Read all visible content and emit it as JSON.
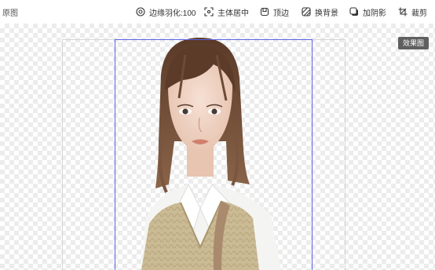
{
  "toolbar": {
    "left_label": "原图",
    "items": [
      {
        "label": "边缘羽化:100",
        "icon": "target-icon"
      },
      {
        "label": "主体居中",
        "icon": "focus-frame-icon"
      },
      {
        "label": "顶边",
        "icon": "top-edge-icon"
      },
      {
        "label": "换背景",
        "icon": "hatched-square-icon"
      },
      {
        "label": "加阴影",
        "icon": "shadow-square-icon"
      },
      {
        "label": "裁剪",
        "icon": "crop-icon"
      }
    ]
  },
  "badge": {
    "label": "效果图"
  },
  "colors": {
    "crop_border": "#5b63e8",
    "checker": "#ececec",
    "badge_bg": "#5f5f5f"
  }
}
